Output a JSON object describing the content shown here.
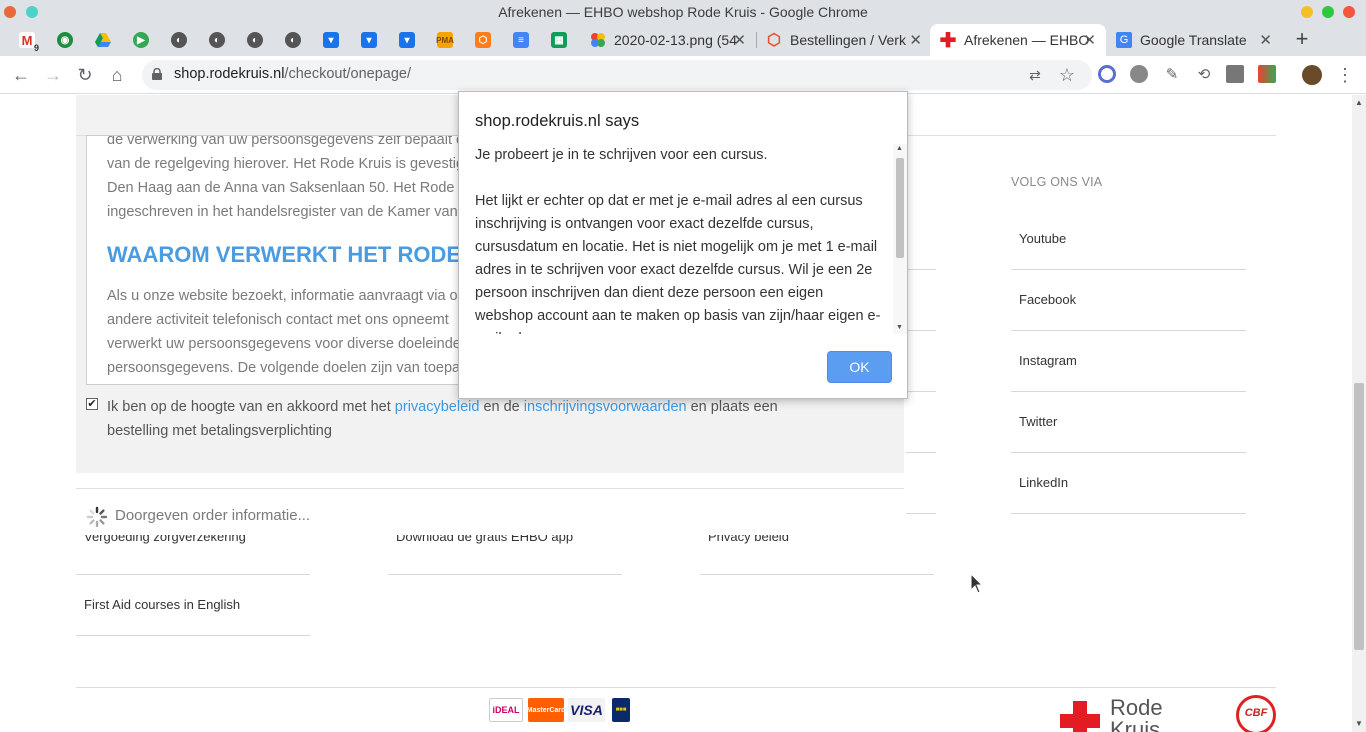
{
  "window": {
    "title": "Afrekenen — EHBO webshop Rode Kruis - Google Chrome"
  },
  "tabs": {
    "pinned_icons": [
      "gmail-icon",
      "maps-icon",
      "drive-icon",
      "play-icon",
      "globe-icon",
      "globe-icon",
      "globe-icon",
      "globe-icon",
      "bookmark-icon",
      "bookmark-icon",
      "bookmark-icon",
      "pma-icon",
      "shield-icon",
      "docs-icon",
      "sheets-icon"
    ],
    "gmail_badge": "9",
    "items": [
      {
        "label": "2020-02-13.png (54",
        "close": "✕"
      },
      {
        "label": "Bestellingen / Verk",
        "close": "✕"
      },
      {
        "label": "Afrekenen — EHBO",
        "close": "✕"
      },
      {
        "label": "Google Translate",
        "close": "✕"
      }
    ],
    "new_tab": "+"
  },
  "toolbar": {
    "url_host": "shop.rodekruis.nl",
    "url_path": "/checkout/onepage/"
  },
  "terms": {
    "lines_top": [
      "de verwerking van uw persoonsgegevens zelf bepaalt e",
      "van de regelgeving hierover. Het Rode Kruis is gevestig",
      "Den Haag aan de Anna van Saksenlaan 50. Het Rode Kr",
      "ingeschreven in het handelsregister van de Kamer van"
    ],
    "heading": "WAAROM VERWERKT HET RODE KR",
    "lines_bottom": [
      "Als u onze website bezoekt, informatie aanvraagt via o",
      "andere activiteit telefonisch contact met ons opneemt",
      "verwerkt uw persoonsgegevens voor diverse doeleinde",
      "persoonsgegevens. De volgende doelen zijn van toepas"
    ]
  },
  "agreement": {
    "checked_mark": "✔",
    "text_before": "Ik ben op de hoogte van en akkoord met het ",
    "link_privacy": "privacybeleid",
    "text_middle": " en de ",
    "link_conditions": "inschrijvingsvoorwaarden",
    "text_after": " en plaats een bestelling met betalingsverplichting"
  },
  "order": {
    "status": "Doorgeven order informatie..."
  },
  "footer": {
    "links_col1": [
      "Vergoeding zorgverzekering",
      "First Aid courses in English"
    ],
    "links_col2": [
      "Download de gratis EHBO app"
    ],
    "links_col3": [
      "Privacy beleid"
    ]
  },
  "social": {
    "title": "VOLG ONS VIA",
    "items": [
      "Youtube",
      "Facebook",
      "Instagram",
      "Twitter",
      "LinkedIn"
    ]
  },
  "payments": {
    "ideal": "iDEAL",
    "mastercard": "MasterCard",
    "visa": "VISA",
    "other": "■■■"
  },
  "branding": {
    "name_line1": "Rode",
    "name_line2": "Kruis",
    "cbf": "CBF"
  },
  "dialog": {
    "title": "shop.rodekruis.nl says",
    "paragraph1": "Je probeert je in te schrijven voor een cursus.",
    "paragraph2": "Het lijkt er echter op dat er met je e-mail adres al een cursus inschrijving is ontvangen voor exact dezelfde cursus, cursusdatum en locatie. Het is niet mogelijk om je met 1 e-mail adres in te schrijven voor exact dezelfde cursus. Wil je een 2e persoon inschrijven dan dient deze persoon een eigen webshop account aan te maken op basis van zijn/haar eigen e-mail adres.",
    "ok": "OK"
  },
  "colors": {
    "accent_blue": "#4a9be0",
    "link_blue": "#3a9ae6",
    "ok_button": "#5b9df0",
    "red_cross": "#e31b23"
  }
}
